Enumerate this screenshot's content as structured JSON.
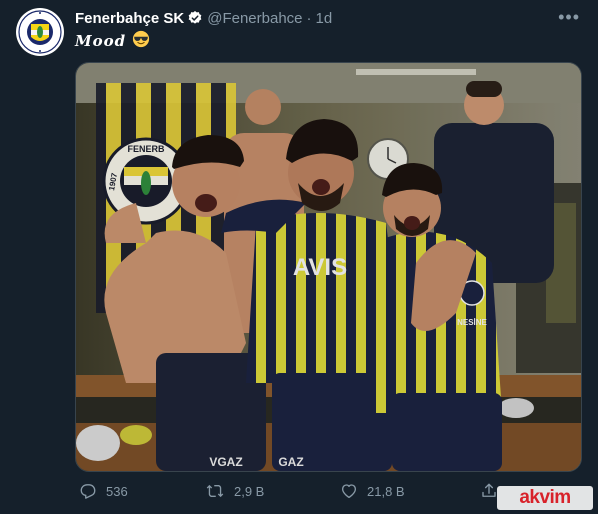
{
  "tweet": {
    "author_name": "Fenerbahçe SK",
    "handle": "@Fenerbahce",
    "separator": "·",
    "time": "1d",
    "text": "Mood",
    "emoji": "sunglasses-face",
    "verified_icon": "verified-badge-icon"
  },
  "avatar": {
    "logo_text": "FENERBAHÇE SPOR KULÜBÜ",
    "logo_year": "1907"
  },
  "photo": {
    "wall_logo_text": "FENERB",
    "wall_logo_year": "1907",
    "shirt_sponsor": "AVIS",
    "shorts_sponsor_left": "GAZ",
    "shorts_sponsor_right": "VGAZ",
    "nesine_text": "NESİNE"
  },
  "actions": {
    "reply_count": "536",
    "retweet_count": "2,9 B",
    "like_count": "21,8 B"
  },
  "watermark": {
    "text": "akvim"
  },
  "colors": {
    "background": "#15202b",
    "muted": "#8899a6",
    "fb_yellow": "#f5d515",
    "fb_navy": "#18203f"
  }
}
